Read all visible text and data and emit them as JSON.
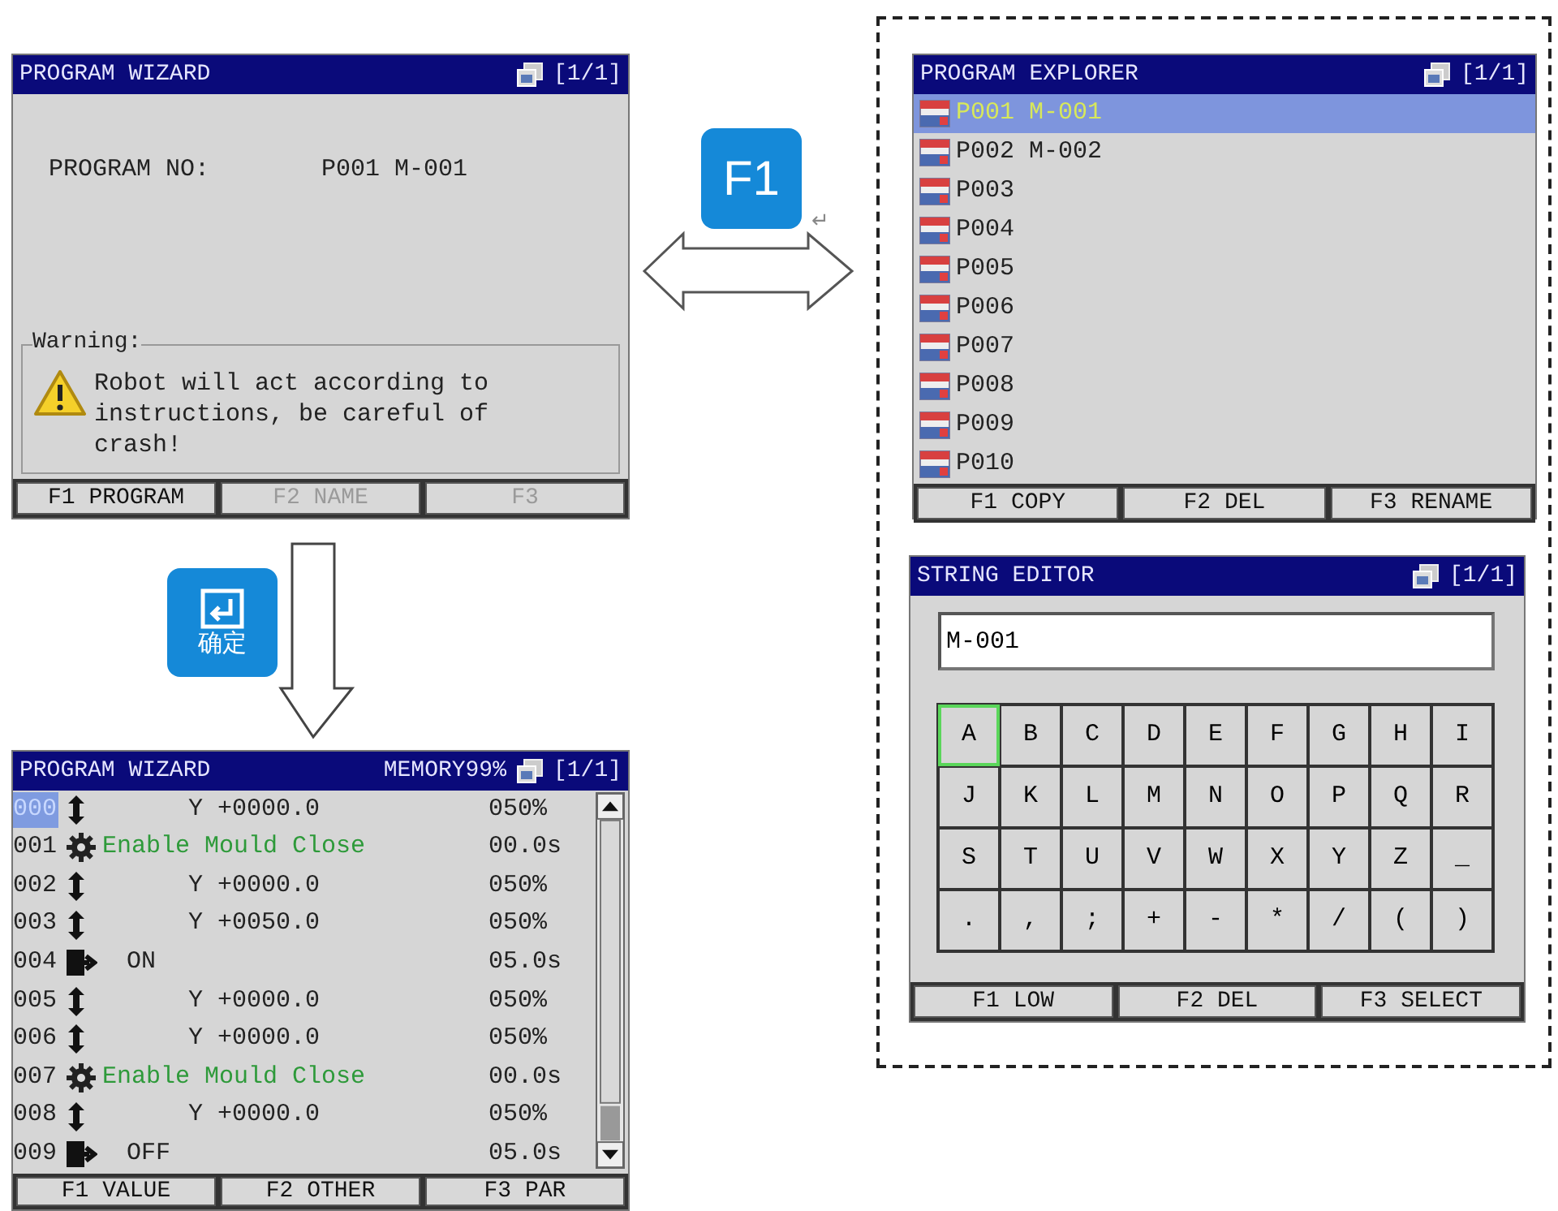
{
  "program_wizard": {
    "title": "PROGRAM WIZARD",
    "page": "[1/1]",
    "program_no_label": "PROGRAM NO:",
    "program_no_value": "P001 M-001",
    "warning": {
      "legend": "Warning:",
      "message": "Robot will act according to instructions, be careful of crash!"
    },
    "function_keys": [
      {
        "label": "F1 PROGRAM",
        "disabled": false
      },
      {
        "label": "F2 NAME",
        "disabled": true
      },
      {
        "label": "F3",
        "disabled": true
      }
    ]
  },
  "enter_key": {
    "label": "确定"
  },
  "f1_key": {
    "label": "F1",
    "mark": "↵"
  },
  "program_list": {
    "title": "PROGRAM WIZARD",
    "memory": "MEMORY99%",
    "page": "[1/1]",
    "rows": [
      {
        "line": "000",
        "kind": "move",
        "text": "Y +0000.0",
        "value": "050%",
        "selected": true
      },
      {
        "line": "001",
        "kind": "function",
        "text": "Enable Mould Close",
        "value": "00.0s",
        "selected": false
      },
      {
        "line": "002",
        "kind": "move",
        "text": "Y +0000.0",
        "value": "050%",
        "selected": false
      },
      {
        "line": "003",
        "kind": "move",
        "text": "Y +0050.0",
        "value": "050%",
        "selected": false
      },
      {
        "line": "004",
        "kind": "output",
        "text": "ON",
        "value": "05.0s",
        "selected": false
      },
      {
        "line": "005",
        "kind": "move",
        "text": "Y +0000.0",
        "value": "050%",
        "selected": false
      },
      {
        "line": "006",
        "kind": "move",
        "text": "Y +0000.0",
        "value": "050%",
        "selected": false
      },
      {
        "line": "007",
        "kind": "function",
        "text": "Enable Mould Close",
        "value": "00.0s",
        "selected": false
      },
      {
        "line": "008",
        "kind": "move",
        "text": "Y +0000.0",
        "value": "050%",
        "selected": false
      },
      {
        "line": "009",
        "kind": "output",
        "text": "OFF",
        "value": "05.0s",
        "selected": false
      }
    ],
    "function_keys": [
      {
        "label": "F1 VALUE",
        "disabled": false
      },
      {
        "label": "F2 OTHER",
        "disabled": false
      },
      {
        "label": "F3 PAR",
        "disabled": false
      }
    ]
  },
  "program_explorer": {
    "title": "PROGRAM EXPLORER",
    "page": "[1/1]",
    "items": [
      {
        "label": "P001 M-001",
        "selected": true
      },
      {
        "label": "P002 M-002",
        "selected": false
      },
      {
        "label": "P003",
        "selected": false
      },
      {
        "label": "P004",
        "selected": false
      },
      {
        "label": "P005",
        "selected": false
      },
      {
        "label": "P006",
        "selected": false
      },
      {
        "label": "P007",
        "selected": false
      },
      {
        "label": "P008",
        "selected": false
      },
      {
        "label": "P009",
        "selected": false
      },
      {
        "label": "P010",
        "selected": false
      }
    ],
    "function_keys": [
      {
        "label": "F1 COPY",
        "disabled": false
      },
      {
        "label": "F2 DEL",
        "disabled": false
      },
      {
        "label": "F3 RENAME",
        "disabled": false
      }
    ]
  },
  "string_editor": {
    "title": "STRING EDITOR",
    "page": "[1/1]",
    "value": "M-001",
    "keys": [
      {
        "label": "A",
        "selected": true
      },
      {
        "label": "B",
        "selected": false
      },
      {
        "label": "C",
        "selected": false
      },
      {
        "label": "D",
        "selected": false
      },
      {
        "label": "E",
        "selected": false
      },
      {
        "label": "F",
        "selected": false
      },
      {
        "label": "G",
        "selected": false
      },
      {
        "label": "H",
        "selected": false
      },
      {
        "label": "I",
        "selected": false
      },
      {
        "label": "J",
        "selected": false
      },
      {
        "label": "K",
        "selected": false
      },
      {
        "label": "L",
        "selected": false
      },
      {
        "label": "M",
        "selected": false
      },
      {
        "label": "N",
        "selected": false
      },
      {
        "label": "O",
        "selected": false
      },
      {
        "label": "P",
        "selected": false
      },
      {
        "label": "Q",
        "selected": false
      },
      {
        "label": "R",
        "selected": false
      },
      {
        "label": "S",
        "selected": false
      },
      {
        "label": "T",
        "selected": false
      },
      {
        "label": "U",
        "selected": false
      },
      {
        "label": "V",
        "selected": false
      },
      {
        "label": "W",
        "selected": false
      },
      {
        "label": "X",
        "selected": false
      },
      {
        "label": "Y",
        "selected": false
      },
      {
        "label": "Z",
        "selected": false
      },
      {
        "label": "_",
        "selected": false
      },
      {
        "label": ".",
        "selected": false
      },
      {
        "label": ",",
        "selected": false
      },
      {
        "label": ";",
        "selected": false
      },
      {
        "label": "+",
        "selected": false
      },
      {
        "label": "-",
        "selected": false
      },
      {
        "label": "*",
        "selected": false
      },
      {
        "label": "/",
        "selected": false
      },
      {
        "label": "(",
        "selected": false
      },
      {
        "label": ")",
        "selected": false
      }
    ],
    "function_keys": [
      {
        "label": "F1 LOW",
        "disabled": false
      },
      {
        "label": "F2 DEL",
        "disabled": false
      },
      {
        "label": "F3 SELECT",
        "disabled": false
      }
    ]
  }
}
